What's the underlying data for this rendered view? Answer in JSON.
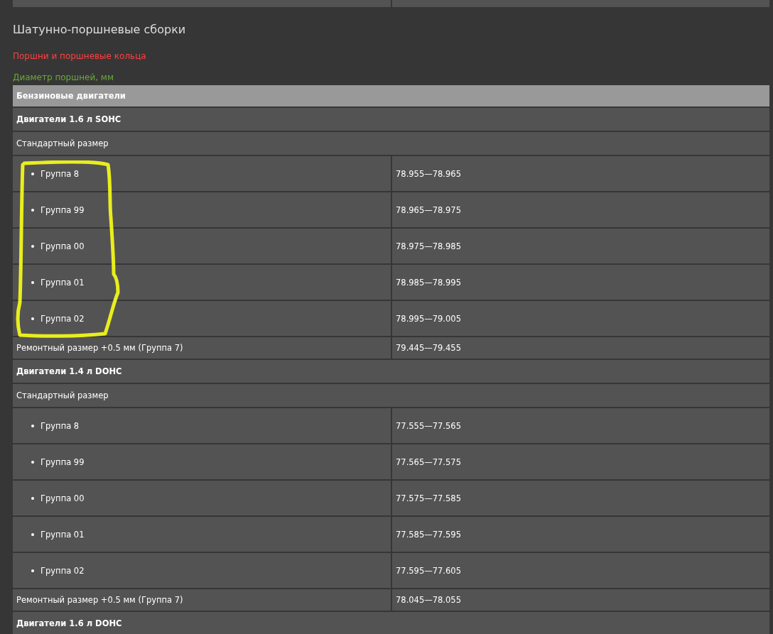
{
  "section_title": "Шатунно-поршневые сборки",
  "subsection_title": "Поршни и поршневые кольца",
  "table_caption": "Диаметр поршней, мм",
  "rows": [
    {
      "kind": "header",
      "label": "Бензиновые двигатели"
    },
    {
      "kind": "group",
      "label": "Двигатели 1.6 л SOHC"
    },
    {
      "kind": "subgroup",
      "label": "Стандартный размер"
    },
    {
      "kind": "item",
      "label": "Группа 8",
      "value": "78.955—78.965"
    },
    {
      "kind": "item",
      "label": "Группа 99",
      "value": "78.965—78.975"
    },
    {
      "kind": "item",
      "label": "Группа 00",
      "value": "78.975—78.985"
    },
    {
      "kind": "item",
      "label": "Группа 01",
      "value": "78.985—78.995"
    },
    {
      "kind": "item",
      "label": "Группа 02",
      "value": "78.995—79.005"
    },
    {
      "kind": "pair",
      "label": "Ремонтный размер +0.5 мм (Группа 7)",
      "value": "79.445—79.455"
    },
    {
      "kind": "group",
      "label": "Двигатели 1.4 л DOHC"
    },
    {
      "kind": "subgroup",
      "label": "Стандартный размер"
    },
    {
      "kind": "item",
      "label": "Группа 8",
      "value": "77.555—77.565"
    },
    {
      "kind": "item",
      "label": "Группа 99",
      "value": "77.565—77.575"
    },
    {
      "kind": "item",
      "label": "Группа 00",
      "value": "77.575—77.585"
    },
    {
      "kind": "item",
      "label": "Группа 01",
      "value": "77.585—77.595"
    },
    {
      "kind": "item",
      "label": "Группа 02",
      "value": "77.595—77.605"
    },
    {
      "kind": "pair",
      "label": "Ремонтный размер +0.5 мм (Группа 7)",
      "value": "78.045—78.055"
    },
    {
      "kind": "group",
      "label": "Двигатели 1.6 л DOHC"
    }
  ]
}
